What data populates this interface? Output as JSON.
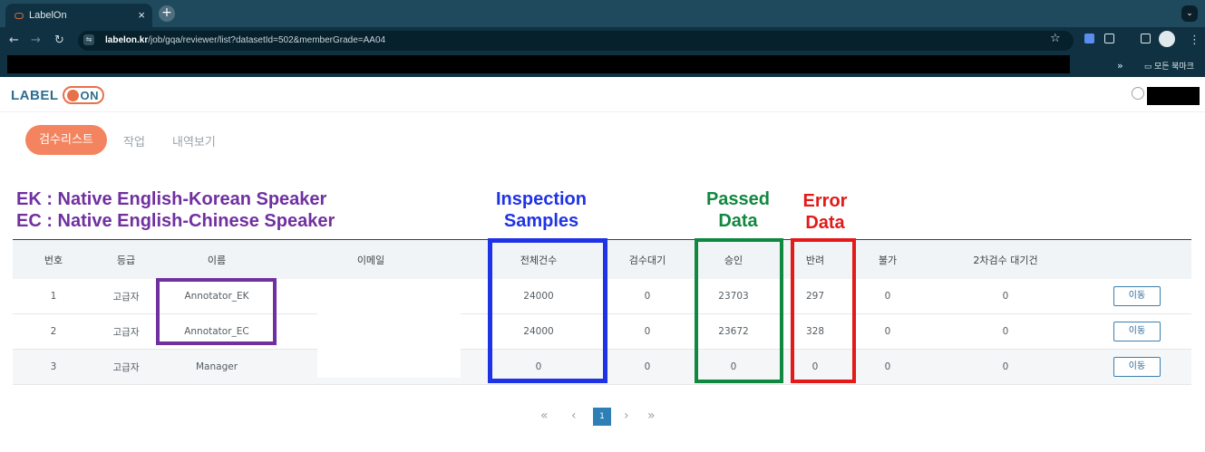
{
  "browser": {
    "tab_title": "LabelOn",
    "tab_close": "×",
    "new_tab": "+",
    "url_host": "labelon.kr",
    "url_path": "/job/gqa/reviewer/list?datasetId=502&memberGrade=AA04",
    "bookmarks_folder": "모든 북마크",
    "bookmarks_overflow": "»"
  },
  "app": {
    "logo_text": "LABEL",
    "logo_on": "ON"
  },
  "page_tabs": [
    {
      "label": "검수리스트",
      "active": true
    },
    {
      "label": "작업",
      "active": false
    },
    {
      "label": "내역보기",
      "active": false
    }
  ],
  "annotations": {
    "legend_line1": "EK : Native English-Korean Speaker",
    "legend_line2": "EC : Native English-Chinese Speaker",
    "inspection_line1": "Inspection",
    "inspection_line2": "Samples",
    "passed_line1": "Passed",
    "passed_line2": "Data",
    "error_line1": "Error",
    "error_line2": "Data",
    "colors": {
      "purple": "#7030a0",
      "blue": "#1f33e6",
      "green": "#10883f",
      "red": "#e21a1a"
    }
  },
  "table": {
    "headers": [
      "번호",
      "등급",
      "이름",
      "이메일",
      "전체건수",
      "검수대기",
      "승인",
      "반려",
      "불가",
      "2차검수 대기건",
      ""
    ],
    "rows": [
      {
        "no": "1",
        "grade": "고급자",
        "name": "Annotator_EK",
        "email": "",
        "total": "24000",
        "pending": "0",
        "approved": "23703",
        "rejected": "297",
        "impossible": "0",
        "second_pending": "0",
        "action": "이동"
      },
      {
        "no": "2",
        "grade": "고급자",
        "name": "Annotator_EC",
        "email": "",
        "total": "24000",
        "pending": "0",
        "approved": "23672",
        "rejected": "328",
        "impossible": "0",
        "second_pending": "0",
        "action": "이동"
      },
      {
        "no": "3",
        "grade": "고급자",
        "name": "Manager",
        "email": "",
        "total": "0",
        "pending": "0",
        "approved": "0",
        "rejected": "0",
        "impossible": "0",
        "second_pending": "0",
        "action": "이동"
      }
    ]
  },
  "pagination": {
    "first": "«",
    "prev": "‹",
    "current": "1",
    "next": "›",
    "last": "»"
  }
}
